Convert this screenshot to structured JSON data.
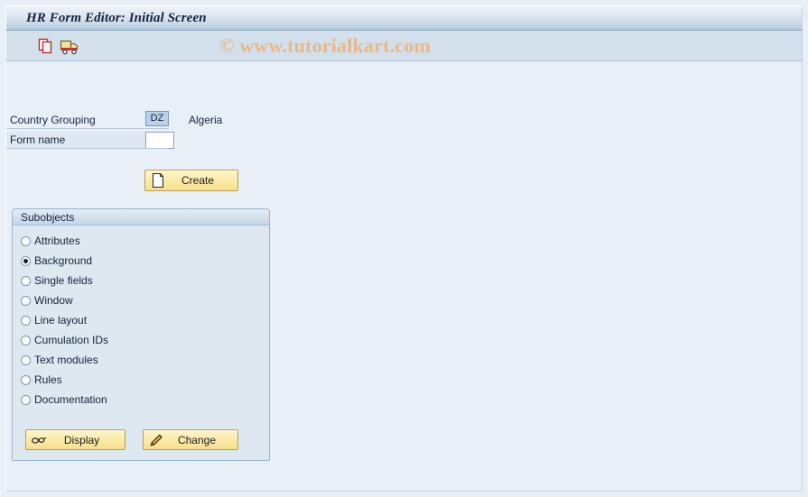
{
  "window": {
    "title": "HR Form Editor: Initial Screen"
  },
  "watermark": {
    "text": "© www.tutorialkart.com"
  },
  "toolbar": {
    "buttons": [
      {
        "name": "copy-icon",
        "tooltip": "Copy"
      },
      {
        "name": "truck-icon",
        "tooltip": "Transport"
      }
    ]
  },
  "form": {
    "country_grouping": {
      "label": "Country Grouping",
      "value": "DZ",
      "description": "Algeria"
    },
    "form_name": {
      "label": "Form name",
      "value": "",
      "placeholder": ""
    },
    "create_button": {
      "label": "Create",
      "icon": "new-document-icon"
    }
  },
  "subobjects": {
    "title": "Subobjects",
    "selected": "Background",
    "options": [
      {
        "label": "Attributes",
        "checked": false
      },
      {
        "label": "Background",
        "checked": true
      },
      {
        "label": "Single fields",
        "checked": false
      },
      {
        "label": "Window",
        "checked": false
      },
      {
        "label": "Line layout",
        "checked": false
      },
      {
        "label": "Cumulation IDs",
        "checked": false
      },
      {
        "label": "Text modules",
        "checked": false
      },
      {
        "label": "Rules",
        "checked": false
      },
      {
        "label": "Documentation",
        "checked": false
      }
    ],
    "display_button": {
      "label": "Display",
      "icon": "glasses-icon"
    },
    "change_button": {
      "label": "Change",
      "icon": "pencil-icon"
    }
  },
  "colors": {
    "window_background": "#e9eff6",
    "title_bar": "#c6d7e8",
    "toolbar": "#d3dfeb",
    "panel_background": "#dde8f1",
    "button_yellow": "#fbeaa6",
    "selected_field": "#b8d0e8",
    "watermark": "#e9b783"
  }
}
